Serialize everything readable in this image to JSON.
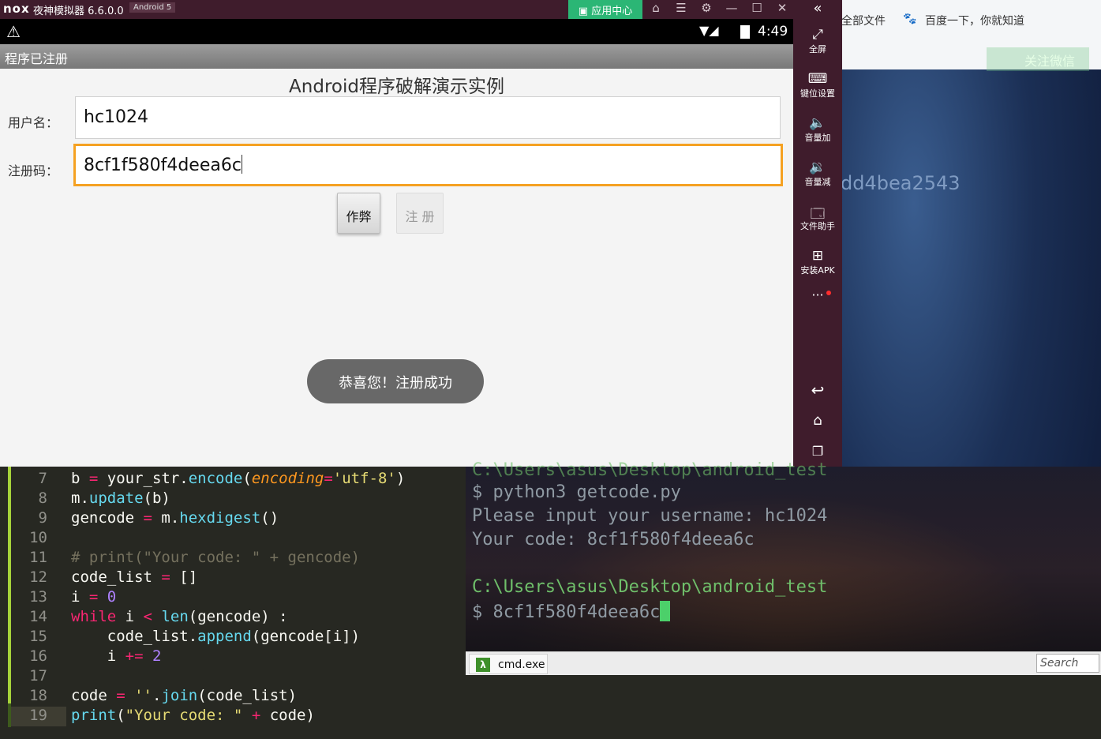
{
  "emulator": {
    "logo": "nox",
    "title": "夜神模拟器 6.6.0.0",
    "android_version": "Android 5",
    "app_center": "应用中心",
    "status_time": "4:49"
  },
  "side_toolbar": {
    "items": [
      {
        "label": "全屏",
        "icon": "⤢"
      },
      {
        "label": "键位设置",
        "icon": "⌨"
      },
      {
        "label": "音量加",
        "icon": "🔈"
      },
      {
        "label": "音量减",
        "icon": "🔉"
      },
      {
        "label": "文件助手",
        "icon": "🗔"
      },
      {
        "label": "安装APK",
        "icon": "⊞"
      }
    ],
    "more": "···"
  },
  "app": {
    "action_bar_title": "程序已注册",
    "heading": "Android程序破解演示实例",
    "username_label": "用户名：",
    "username_value": "hc1024",
    "code_label": "注册码：",
    "code_value": "8cf1f580f4deea6c",
    "cheat_button": "作弊",
    "register_button": "注 册",
    "toast": "恭喜您！注册成功"
  },
  "background": {
    "bookmark_files": "全部文件",
    "bookmark_baidu": "百度一下，你就知道",
    "hash_fragment": "dd4bea2543",
    "follow_wechat": "关注微信"
  },
  "editor": {
    "lines": [
      {
        "n": "7"
      },
      {
        "n": "8"
      },
      {
        "n": "9"
      },
      {
        "n": "10"
      },
      {
        "n": "11"
      },
      {
        "n": "12"
      },
      {
        "n": "13"
      },
      {
        "n": "14"
      },
      {
        "n": "15"
      },
      {
        "n": "16"
      },
      {
        "n": "17"
      },
      {
        "n": "18"
      },
      {
        "n": "19"
      }
    ]
  },
  "terminal": {
    "path_top": "C:\\Users\\asus\\Desktop\\android_test",
    "cmd1": "$ python3 getcode.py",
    "prompt": "Please input your username: hc1024",
    "output": "Your code: 8cf1f580f4deea6c",
    "path": "C:\\Users\\asus\\Desktop\\android_test",
    "cmd2": "$ 8cf1f580f4deea6c",
    "tab_label": "cmd.exe",
    "search_placeholder": "Search"
  }
}
